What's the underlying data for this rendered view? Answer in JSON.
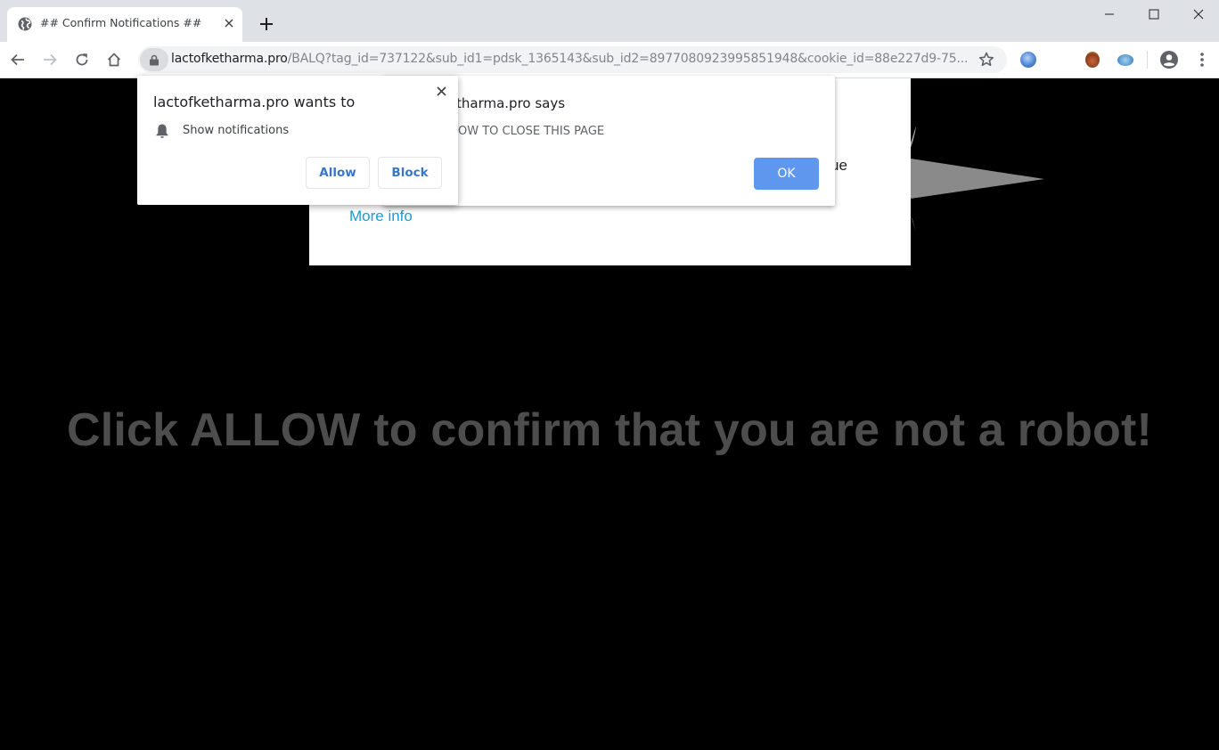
{
  "browser": {
    "tab": {
      "title": "## Confirm Notifications ##",
      "favicon": "globe-icon",
      "close_icon": "close-icon"
    },
    "new_tab_icon": "plus-icon",
    "window_controls": [
      "minimize-icon",
      "maximize-icon",
      "close-icon"
    ],
    "toolbar": {
      "back_icon": "arrow-left-icon",
      "forward_icon": "arrow-right-icon",
      "reload_icon": "reload-icon",
      "home_icon": "home-icon",
      "url_host": "lactofketharma.pro",
      "url_rest": "/BALQ?tag_id=737122&sub_id1=pdsk_1365143&sub_id2=8977080923995851948&cookie_id=88e227d9-75...",
      "bookmark_icon": "star-icon",
      "extensions": [
        "extension-blue-icon",
        "extension-brown-icon",
        "extension-teal-icon"
      ],
      "profile_icon": "account-circle-icon",
      "menu_icon": "more-vert-icon"
    }
  },
  "page": {
    "card_text_fragment": "ue",
    "more_info_link": "More info",
    "headline": "Click ALLOW to confirm that you are not a robot!"
  },
  "alert_dialog": {
    "title_visible": "tharma.pro says",
    "message_visible": "OW TO CLOSE THIS PAGE",
    "ok_label": "OK"
  },
  "permission_prompt": {
    "title": "lactofketharma.pro wants to",
    "permission": "Show notifications",
    "permission_icon": "bell-icon",
    "allow_label": "Allow",
    "block_label": "Block"
  },
  "colors": {
    "tabstrip_bg": "#dee1e6",
    "page_bg": "#000000",
    "headline": "#4d4d4d",
    "link": "#1a9bd7",
    "ok_button": "#5f97ef",
    "prompt_button_text": "#3b76c4"
  }
}
